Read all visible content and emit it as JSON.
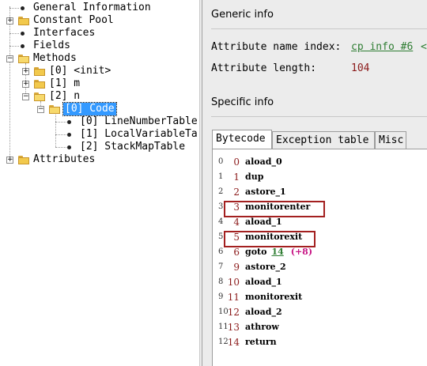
{
  "tree": {
    "general_information": "General Information",
    "constant_pool": "Constant Pool",
    "interfaces": "Interfaces",
    "fields": "Fields",
    "methods": "Methods",
    "method_0": "[0] <init>",
    "method_1": "[1] m",
    "method_2": "[2] n",
    "code_node": "[0] Code",
    "code_attr_0": "[0] LineNumberTable",
    "code_attr_1": "[1] LocalVariableTa",
    "code_attr_2": "[2] StackMapTable",
    "attributes": "Attributes"
  },
  "generic_info": {
    "title": "Generic info",
    "name_index_label": "Attribute name index:",
    "name_index_link": "cp info #6",
    "length_label": "Attribute length:",
    "length_value": "104"
  },
  "specific_info": {
    "title": "Specific info",
    "tabs": [
      "Bytecode",
      "Exception table",
      "Misc"
    ],
    "active_tab": "Bytecode"
  },
  "bytecode": [
    {
      "idx": "0",
      "offset": "0",
      "instr": "aload_0"
    },
    {
      "idx": "1",
      "offset": "1",
      "instr": "dup"
    },
    {
      "idx": "2",
      "offset": "2",
      "instr": "astore_1"
    },
    {
      "idx": "3",
      "offset": "3",
      "instr": "monitorenter"
    },
    {
      "idx": "4",
      "offset": "4",
      "instr": "aload_1"
    },
    {
      "idx": "5",
      "offset": "5",
      "instr": "monitorexit"
    },
    {
      "idx": "6",
      "offset": "6",
      "instr": "goto",
      "target": "14",
      "relative": "(+8)"
    },
    {
      "idx": "7",
      "offset": "9",
      "instr": "astore_2"
    },
    {
      "idx": "8",
      "offset": "10",
      "instr": "aload_1"
    },
    {
      "idx": "9",
      "offset": "11",
      "instr": "monitorexit"
    },
    {
      "idx": "10",
      "offset": "12",
      "instr": "aload_2"
    },
    {
      "idx": "11",
      "offset": "13",
      "instr": "athrow"
    },
    {
      "idx": "12",
      "offset": "14",
      "instr": "return"
    }
  ],
  "colors": {
    "selection": "#3399ff",
    "link": "#2e7d32",
    "offset": "#8b1a1a",
    "highlight_box": "#a32020",
    "relative_jump": "#c71585"
  },
  "icons": [
    "bullet-icon",
    "folder-icon",
    "folder-open-icon",
    "expand-plus-icon",
    "collapse-minus-icon"
  ]
}
